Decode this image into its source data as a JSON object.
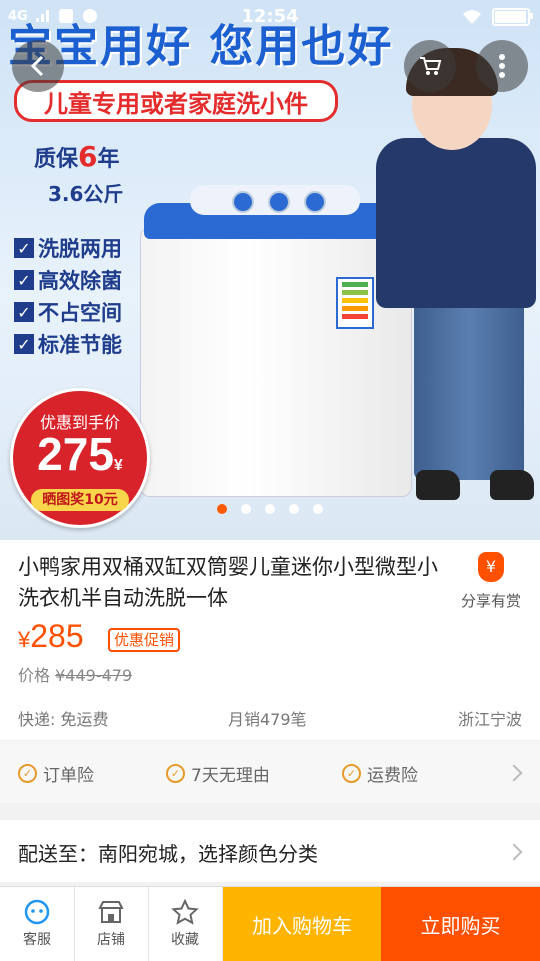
{
  "status_bar": {
    "network": "4G",
    "time": "12:54"
  },
  "hero": {
    "headline": "宝宝用好 您用也好",
    "sub_banner": "儿童专用或者家庭洗小件",
    "warranty_prefix": "质保",
    "warranty_years": "6",
    "warranty_suffix": "年",
    "weight": "3.6公斤",
    "features": [
      "洗脱两用",
      "高效除菌",
      "不占空间",
      "标准节能"
    ],
    "badge": {
      "label": "优惠到手价",
      "price": "275",
      "currency": "¥",
      "bonus": "晒图奖10元"
    },
    "carousel": {
      "total": 5,
      "active_index": 0
    }
  },
  "product": {
    "title": "小鸭家用双桶双缸双筒婴儿童迷你小型微型小洗衣机半自动洗脱一体",
    "share_label": "分享有赏",
    "share_icon_glyph": "¥",
    "currency": "¥",
    "price": "285",
    "promo_tag": "优惠促销",
    "orig_label": "价格",
    "orig_price": "¥449-479",
    "shipping": "快递: 免运费",
    "monthly_sales": "月销479笔",
    "location": "浙江宁波"
  },
  "services": [
    "订单险",
    "7天无理由",
    "运费险"
  ],
  "delivery": {
    "text": "配送至：南阳宛城，选择颜色分类"
  },
  "bottom_bar": {
    "tabs": [
      {
        "label": "客服",
        "icon": "customer-service-icon"
      },
      {
        "label": "店铺",
        "icon": "store-icon"
      },
      {
        "label": "收藏",
        "icon": "star-icon"
      }
    ],
    "add_to_cart": "加入购物车",
    "buy_now": "立即购买"
  },
  "colors": {
    "accent": "#ff5000",
    "cart": "#ffb400"
  }
}
